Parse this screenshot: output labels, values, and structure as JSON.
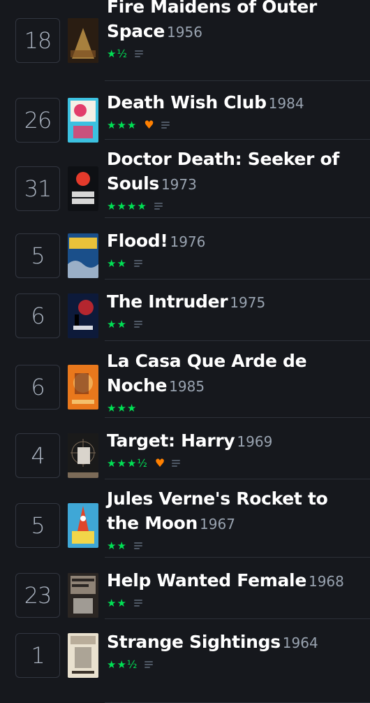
{
  "diary": {
    "entries": [
      {
        "day": "18",
        "title": "Fire Maidens of Outer Space",
        "year": "1956",
        "rating": "★½",
        "liked": false,
        "has_review": true,
        "poster_palette": [
          "#2a1d12",
          "#c79a4a",
          "#7a4f22"
        ]
      },
      {
        "day": "26",
        "title": "Death Wish Club",
        "year": "1984",
        "rating": "★★★",
        "liked": true,
        "has_review": true,
        "poster_palette": [
          "#3cc1e0",
          "#e23d6b",
          "#f5f0e6"
        ]
      },
      {
        "day": "31",
        "title": "Doctor Death: Seeker of Souls",
        "year": "1973",
        "rating": "★★★★",
        "liked": false,
        "has_review": true,
        "poster_palette": [
          "#0e1014",
          "#d7d7d7",
          "#e43a2b"
        ]
      },
      {
        "day": "5",
        "title": "Flood!",
        "year": "1976",
        "rating": "★★",
        "liked": false,
        "has_review": true,
        "poster_palette": [
          "#1a4f8a",
          "#e9c23a",
          "#f0f0f0"
        ]
      },
      {
        "day": "6",
        "title": "The Intruder",
        "year": "1975",
        "rating": "★★",
        "liked": false,
        "has_review": true,
        "poster_palette": [
          "#0d1a3a",
          "#d8dbe4",
          "#c7282f"
        ]
      },
      {
        "day": "6",
        "title": "La Casa Que Arde de Noche",
        "year": "1985",
        "rating": "★★★",
        "liked": false,
        "has_review": false,
        "poster_palette": [
          "#e9781c",
          "#6b2a14",
          "#f4c06b"
        ]
      },
      {
        "day": "4",
        "title": "Target: Harry",
        "year": "1969",
        "rating": "★★★½",
        "liked": true,
        "has_review": true,
        "poster_palette": [
          "#1a1a1a",
          "#d9d4cc",
          "#7c6b58"
        ]
      },
      {
        "day": "5",
        "title": "Jules Verne's Rocket to the Moon",
        "year": "1967",
        "rating": "★★",
        "liked": false,
        "has_review": true,
        "poster_palette": [
          "#3fa7d6",
          "#e0452a",
          "#f2d649"
        ]
      },
      {
        "day": "23",
        "title": "Help Wanted Female",
        "year": "1968",
        "rating": "★★",
        "liked": false,
        "has_review": true,
        "poster_palette": [
          "#2b2623",
          "#efeae0",
          "#9a8e80"
        ]
      },
      {
        "day": "1",
        "title": "Strange Sightings",
        "year": "1964",
        "rating": "★★½",
        "liked": false,
        "has_review": true,
        "poster_palette": [
          "#e9e1cf",
          "#8a7a66",
          "#3b332a"
        ]
      }
    ]
  }
}
